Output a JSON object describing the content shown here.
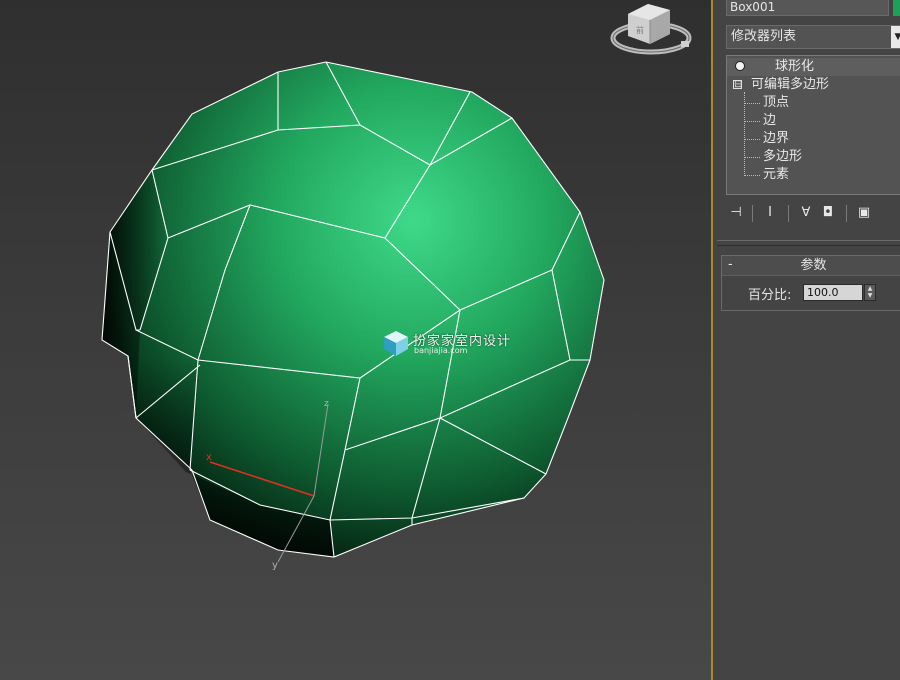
{
  "viewport": {
    "axis_x_label": "x",
    "axis_y_label": "y",
    "axis_z_label": "z",
    "viewcube_face_label": "前",
    "watermark_text": "扮家家室内设计",
    "watermark_url": "banjiajia.com",
    "mesh_color": "#22a85f",
    "wire_color": "#ffffff",
    "accent_border": "#a88a2a"
  },
  "panel": {
    "object_name": "Box001",
    "object_color": "#1fa05a",
    "modifier_list_label": "修改器列表",
    "stack": {
      "top_modifier": "球形化",
      "base_object": "可编辑多边形",
      "expander_symbol": "⊟",
      "sub_objects": [
        "顶点",
        "边",
        "边界",
        "多边形",
        "元素"
      ]
    },
    "toolbar_icons": [
      "pin-stack-icon",
      "show-end-result-icon",
      "make-unique-icon",
      "remove-modifier-icon",
      "configure-modifier-sets-icon"
    ],
    "rollout": {
      "toggle": "-",
      "title": "参数",
      "percent_label": "百分比:",
      "percent_value": "100.0"
    }
  }
}
